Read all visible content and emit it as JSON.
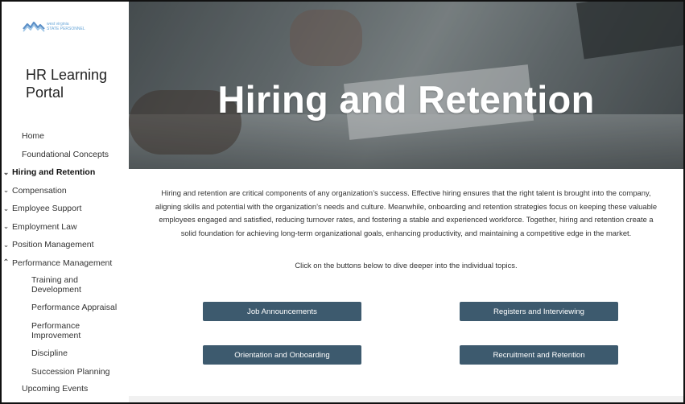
{
  "logo": {
    "text": "west virginia\nSTATE PERSONNEL",
    "icon": "wv-logo-icon"
  },
  "site": {
    "title": "HR Learning Portal"
  },
  "nav": {
    "items": [
      {
        "label": "Home",
        "chevron": "",
        "bold": false
      },
      {
        "label": "Foundational Concepts",
        "chevron": "",
        "bold": false
      },
      {
        "label": "Hiring and Retention",
        "chevron": "down",
        "bold": true
      },
      {
        "label": "Compensation",
        "chevron": "down",
        "bold": false
      },
      {
        "label": "Employee Support",
        "chevron": "down",
        "bold": false
      },
      {
        "label": "Employment Law",
        "chevron": "down",
        "bold": false
      },
      {
        "label": "Position Management",
        "chevron": "down",
        "bold": false
      },
      {
        "label": "Performance Management",
        "chevron": "up",
        "bold": false
      }
    ],
    "sub_items": [
      "Training and Development",
      "Performance Appraisal",
      "Performance Improvement",
      "Discipline",
      "Succession Planning"
    ],
    "last_item": "Upcoming Events"
  },
  "hero": {
    "title": "Hiring and Retention"
  },
  "main": {
    "intro": "Hiring and retention are critical components of any organization’s success. Effective hiring ensures that the right talent is brought into the company, aligning skills and potential with the organization’s needs and culture. Meanwhile, onboarding and retention strategies focus on keeping these valuable employees engaged and satisfied, reducing turnover rates, and fostering a stable and experienced workforce. Together, hiring and retention create a solid foundation for achieving long-term organizational goals, enhancing productivity, and maintaining a competitive edge in the market.",
    "hint": "Click on the buttons below to dive deeper into the individual topics.",
    "buttons": {
      "job_announcements": "Job Announcements",
      "registers": "Registers and Interviewing",
      "orientation": "Orientation and Onboarding",
      "recruitment": "Recruitment and Retention"
    }
  },
  "colors": {
    "button": "#3d5a6e",
    "logo_accent": "#6aa7d8"
  }
}
